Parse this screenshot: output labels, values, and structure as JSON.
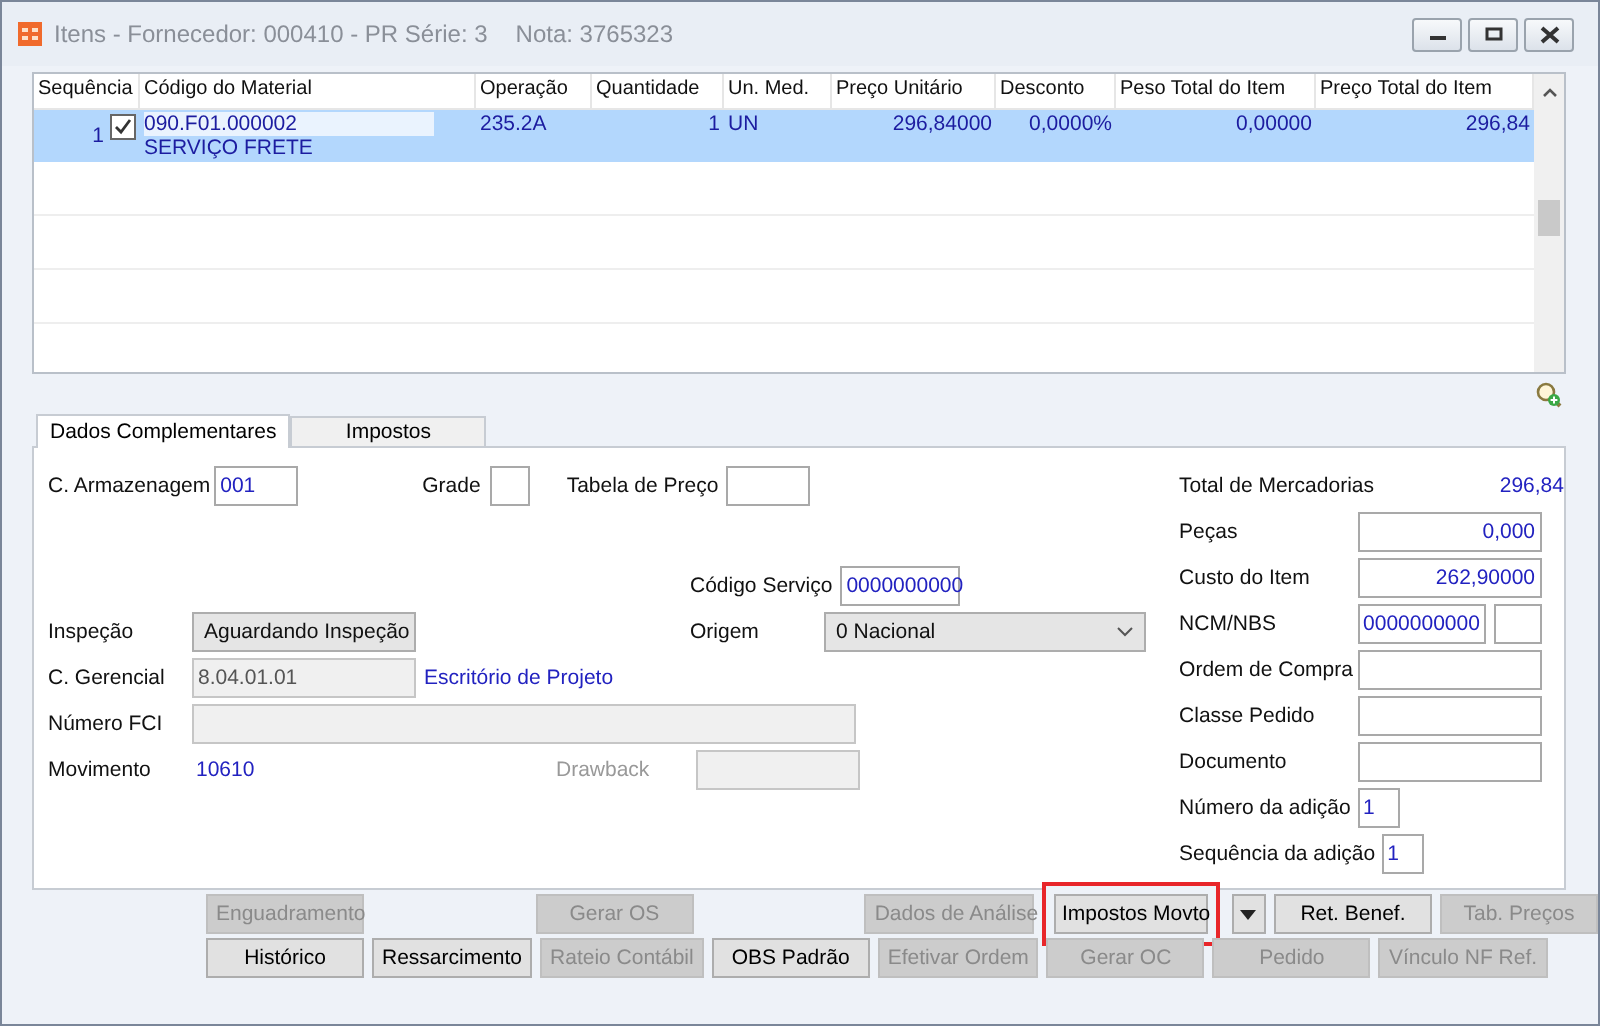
{
  "window": {
    "title": "Itens - Fornecedor: 000410 - PR Série: 3",
    "note": "Nota: 3765323"
  },
  "table": {
    "columns": [
      "Sequência",
      "Código do Material",
      "Operação",
      "Quantidade",
      "Un. Med.",
      "Preço Unitário",
      "Desconto",
      "Peso Total do Item",
      "Preço Total do Item"
    ],
    "rows": [
      {
        "selected": true,
        "checked": true,
        "sequencia": "1",
        "codigo": "090.F01.000002",
        "descricao": "SERVIÇO FRETE",
        "operacao": "235.2A",
        "quantidade": "1",
        "unidade": "UN",
        "preco_unitario": "296,84000",
        "desconto": "0,0000%",
        "peso_total": "0,00000",
        "preco_total": "296,84"
      }
    ]
  },
  "tabs": [
    {
      "label": "Dados Complementares",
      "selected": true
    },
    {
      "label": "Impostos",
      "selected": false
    }
  ],
  "form": {
    "armazenagem": {
      "label": "C. Armazenagem",
      "value": "001"
    },
    "grade": {
      "label": "Grade"
    },
    "tabela_preco": {
      "label": "Tabela de Preço"
    },
    "codigo_servico": {
      "label": "Código Serviço",
      "value": "0000000000"
    },
    "inspecao": {
      "label": "Inspeção",
      "value": "Aguardando Inspeção"
    },
    "origem": {
      "label": "Origem",
      "value": "0 Nacional"
    },
    "gerencial": {
      "label": "C. Gerencial",
      "value": "8.04.01.01",
      "description": "Escritório de Projeto",
      "disabled": true
    },
    "numero_fci": {
      "label": "Número FCI",
      "disabled": true
    },
    "movimento": {
      "label": "Movimento",
      "value": "10610"
    },
    "drawback": {
      "label": "Drawback",
      "disabled": true
    },
    "total_mercadorias": {
      "label": "Total de Mercadorias",
      "value": "296,84"
    },
    "right_fields": [
      {
        "label": "Peças",
        "value": "0,000",
        "kind": "wide"
      },
      {
        "label": "Custo do Item",
        "value": "262,90000",
        "kind": "wide"
      },
      {
        "label": "NCM/NBS",
        "value": "0000000000",
        "kind": "split"
      },
      {
        "label": "Ordem de Compra",
        "kind": "wide"
      },
      {
        "label": "Classe Pedido",
        "kind": "wide"
      },
      {
        "label": "Documento",
        "kind": "wide"
      },
      {
        "label": "Número da adição",
        "value": "1",
        "kind": "short"
      },
      {
        "label": "Sequência da adição",
        "value": "1",
        "kind": "short"
      }
    ]
  },
  "buttons_row1": [
    {
      "label": "Enguadramento",
      "disabled": true,
      "highlighted": false,
      "kind": "button"
    },
    {
      "kind": "gap"
    },
    {
      "label": "Gerar OS",
      "disabled": true,
      "highlighted": false,
      "kind": "button"
    },
    {
      "kind": "gap"
    },
    {
      "label": "Dados de Análise",
      "disabled": true,
      "highlighted": false,
      "kind": "button"
    },
    {
      "label": "Impostos Movto",
      "disabled": false,
      "highlighted": true,
      "kind": "button"
    },
    {
      "kind": "dropdown",
      "disabled": false
    },
    {
      "label": "Ret. Benef.",
      "disabled": false,
      "highlighted": false,
      "kind": "button"
    },
    {
      "label": "Tab. Preços",
      "disabled": true,
      "highlighted": false,
      "kind": "button"
    }
  ],
  "buttons_row2": [
    {
      "label": "Histórico",
      "disabled": false,
      "highlighted": false,
      "kind": "button"
    },
    {
      "label": "Ressarcimento",
      "disabled": false,
      "highlighted": false,
      "kind": "button"
    },
    {
      "label": "Rateio Contábil",
      "disabled": true,
      "highlighted": false,
      "kind": "button"
    },
    {
      "label": "OBS Padrão",
      "disabled": false,
      "highlighted": false,
      "kind": "button"
    },
    {
      "label": "Efetivar Ordem",
      "disabled": true,
      "highlighted": false,
      "kind": "button"
    },
    {
      "label": "Gerar OC",
      "disabled": true,
      "highlighted": false,
      "kind": "button"
    },
    {
      "label": "Pedido",
      "disabled": true,
      "highlighted": false,
      "kind": "button"
    },
    {
      "label": "Vínculo NF Ref.",
      "disabled": true,
      "highlighted": false,
      "kind": "button"
    }
  ]
}
